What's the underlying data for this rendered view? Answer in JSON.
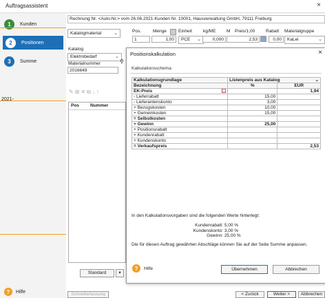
{
  "window": {
    "title": "Auftragsassistent",
    "close": "×"
  },
  "steps": [
    {
      "num": "1",
      "label": "Kunden"
    },
    {
      "num": "2",
      "label": "Positionen"
    },
    {
      "num": "3",
      "label": "Summe"
    }
  ],
  "left_date_label": "2021-",
  "help_label": "Hilfe",
  "document_line": "Rechnung Nr. <Auto-Nr.> vom 26.06.2021-Kunden Nr. 10001, Hausverwaltung GmbH, 79111 Freiburg",
  "catalog_type": "Katalogmaterial",
  "position_fields": {
    "headers": {
      "pos": "Pos.",
      "menge": "Menge",
      "einheit": "Einheit",
      "kg": "kg/ME",
      "m": "M",
      "preis": "Preis/1,00",
      "rabatt": "Rabatt",
      "matgruppe": "Materialgruppe"
    },
    "values": {
      "pos": "1",
      "menge": "1,00",
      "einheit": "PCE",
      "kg": "0,000",
      "preis": "2,53",
      "rabatt": "0,00",
      "matgruppe": "KaLei"
    }
  },
  "katalog": {
    "label": "Katalog",
    "value": "Elektrobedarf",
    "matnr_label": "Materialnummer",
    "matnr_value": "2016649"
  },
  "list": {
    "col_pos": "Pos",
    "col_nummer": "Nummer"
  },
  "standard_button": "Standard",
  "schnellerfassung": "Schnellerfassung",
  "nav": {
    "back": "< Zurück",
    "next": "Weiter >",
    "cancel": "Abbrechen"
  },
  "dialog": {
    "title": "Positionskalkulation",
    "close": "×",
    "schema_label": "Kalkulationsschema",
    "grundlage_label": "Kalkulationsgrundlage",
    "grundlage_value": "Listenpreis aus Katalog",
    "col_bez": "Bezeichnung",
    "col_pct": "%",
    "col_eur": "EUR",
    "rows": [
      {
        "name": "EK-Preis",
        "pct": "",
        "eur": "1,94",
        "bold": true,
        "icon": true
      },
      {
        "name": "- Lieferrabatt",
        "pct": "15,00",
        "eur": ""
      },
      {
        "name": "- Lieferantenskonto",
        "pct": "3,00",
        "eur": ""
      },
      {
        "name": "+ Bezugskosten",
        "pct": "10,00",
        "eur": ""
      },
      {
        "name": "+ Gemeinkosten",
        "pct": "15,00",
        "eur": ""
      },
      {
        "name": "= Selbstkosten",
        "pct": "",
        "eur": "",
        "bold": true
      },
      {
        "name": "+ Gewinn",
        "pct": "25,00",
        "eur": "",
        "bold": true
      },
      {
        "name": "+ Positionsrabatt",
        "pct": "",
        "eur": ""
      },
      {
        "name": "+ Kundenrabatt",
        "pct": "",
        "eur": ""
      },
      {
        "name": "+ Kundenskonto",
        "pct": "",
        "eur": ""
      },
      {
        "name": "= Verkaufspreis",
        "pct": "",
        "eur": "2,53",
        "bold": true
      }
    ],
    "info_text": "In den Kalkulationsvorgaben sind die folgenden Werte hinterlegt:",
    "vals": [
      {
        "label": "Kundenrabatt:",
        "value": "5,00 %"
      },
      {
        "label": "Kundenskonto:",
        "value": "3,00 %"
      },
      {
        "label": "Gewinn:",
        "value": "25,00 %"
      }
    ],
    "footer_text": "Die für diesen Auftrag gewährten Abschläge können Sie auf der Seite Summe anpassen.",
    "hilfe": "Hilfe",
    "apply": "Übernehmen",
    "cancel": "Abbrechen"
  },
  "colors": {
    "accent": "#1e6fb5",
    "green": "#3d8b3d",
    "orange": "#f0a020"
  }
}
